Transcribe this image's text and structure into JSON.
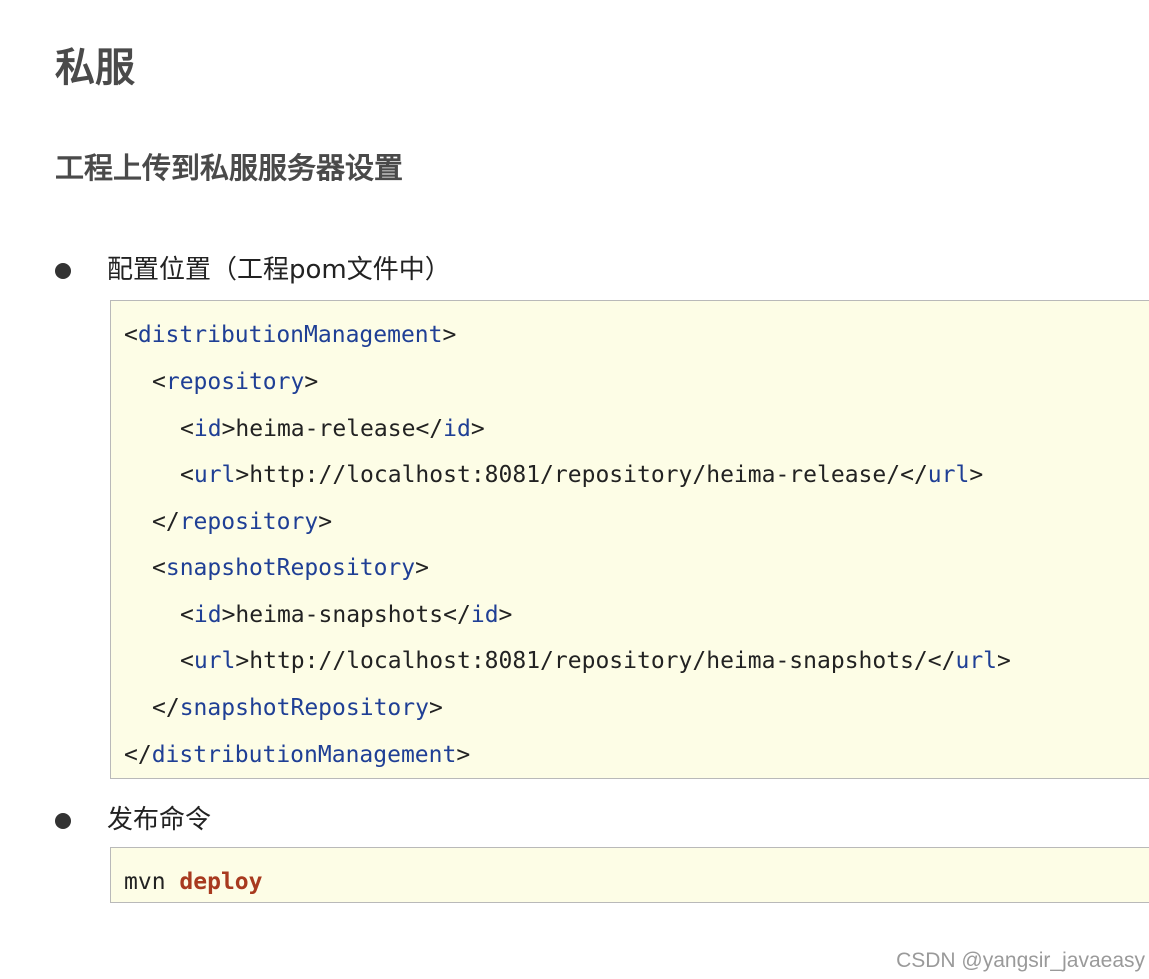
{
  "page": {
    "title": "私服",
    "section_title": "工程上传到私服服务器设置"
  },
  "bullets": [
    {
      "text": "配置位置（工程pom文件中）"
    },
    {
      "text": "发布命令"
    }
  ],
  "code_xml": {
    "lines": [
      {
        "open": "<",
        "tag1": "distributionManagement",
        "mid": ">",
        "content": "",
        "close_open": "",
        "tag2": "",
        "end": ""
      },
      {
        "open": "<",
        "tag1": "repository",
        "mid": ">",
        "content": "",
        "close_open": "",
        "tag2": "",
        "end": ""
      },
      {
        "open": "<",
        "tag1": "id",
        "mid": ">",
        "content": "heima-release",
        "close_open": "</",
        "tag2": "id",
        "end": ">"
      },
      {
        "open": "<",
        "tag1": "url",
        "mid": ">",
        "content": "http://localhost:8081/repository/heima-release/",
        "close_open": "</",
        "tag2": "url",
        "end": ">"
      },
      {
        "open": "</",
        "tag1": "repository",
        "mid": ">",
        "content": "",
        "close_open": "",
        "tag2": "",
        "end": ""
      },
      {
        "open": "<",
        "tag1": "snapshotRepository",
        "mid": ">",
        "content": "",
        "close_open": "",
        "tag2": "",
        "end": ""
      },
      {
        "open": "<",
        "tag1": "id",
        "mid": ">",
        "content": "heima-snapshots",
        "close_open": "</",
        "tag2": "id",
        "end": ">"
      },
      {
        "open": "<",
        "tag1": "url",
        "mid": ">",
        "content": "http://localhost:8081/repository/heima-snapshots/",
        "close_open": "</",
        "tag2": "url",
        "end": ">"
      },
      {
        "open": "</",
        "tag1": "snapshotRepository",
        "mid": ">",
        "content": "",
        "close_open": "",
        "tag2": "",
        "end": ""
      },
      {
        "open": "</",
        "tag1": "distributionManagement",
        "mid": ">",
        "content": "",
        "close_open": "",
        "tag2": "",
        "end": ""
      }
    ]
  },
  "code_cmd": {
    "command": "mvn",
    "argument": "deploy"
  },
  "watermark": "CSDN @yangsir_javaeasy",
  "colors": {
    "code_background": "#fdfde6",
    "tag_name": "#1f3f95",
    "keyword": "#a83a1f",
    "heading": "#4a4a4a"
  }
}
